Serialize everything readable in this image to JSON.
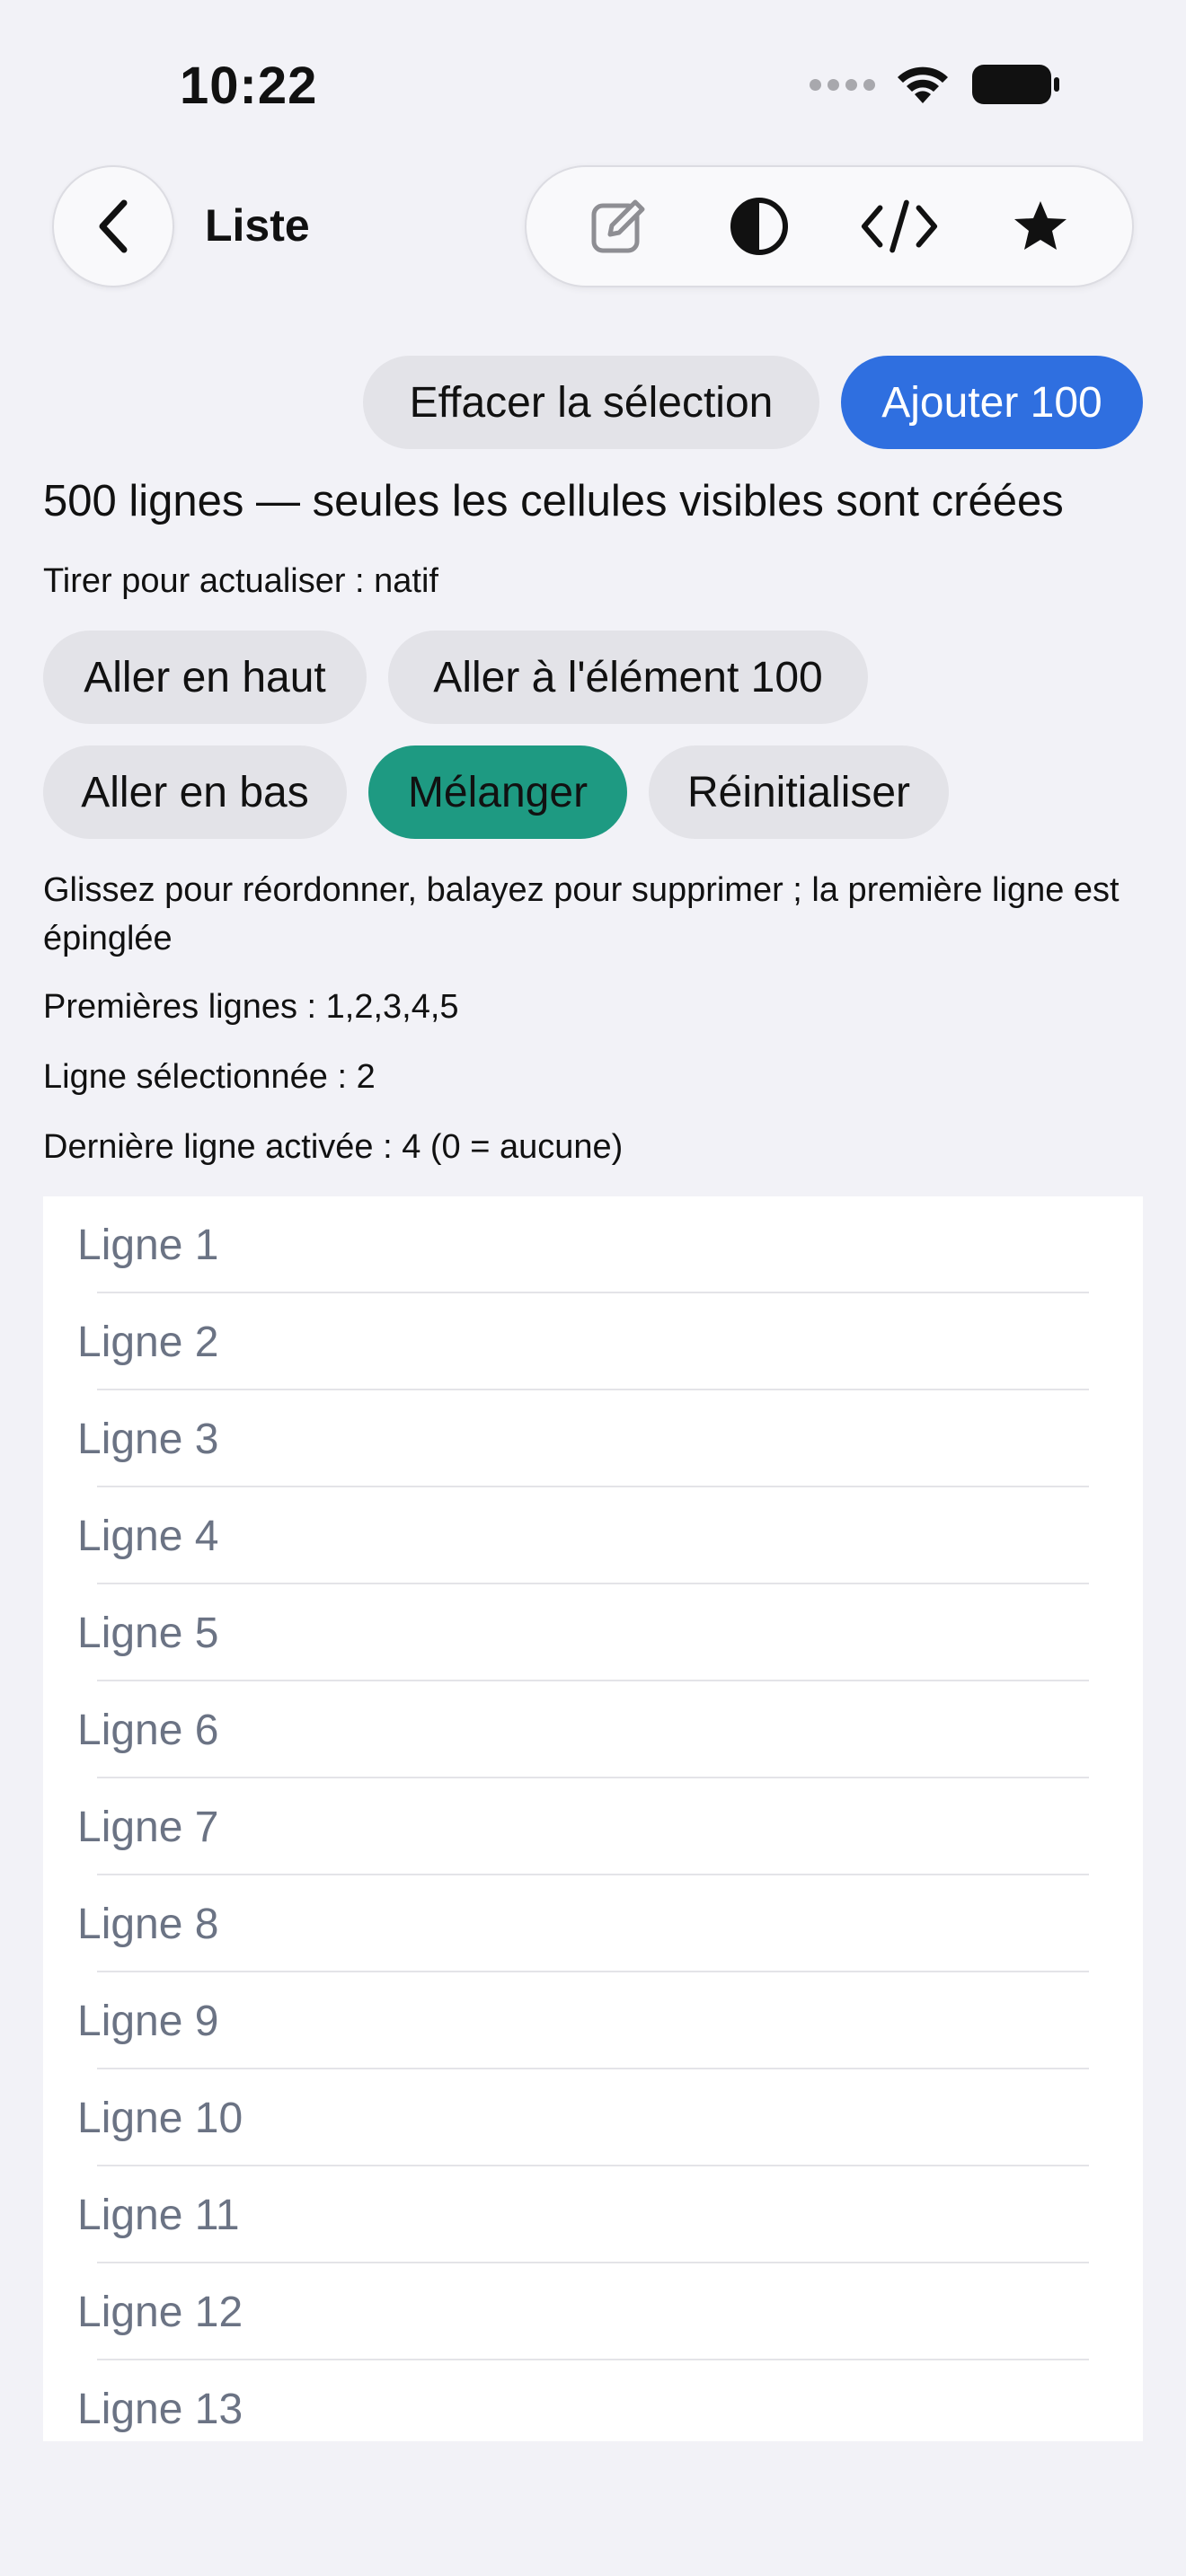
{
  "status": {
    "time": "10:22"
  },
  "nav": {
    "title": "Liste",
    "back_icon": "chevron-left-icon",
    "tools": [
      "edit-icon",
      "contrast-icon",
      "code-icon",
      "star-icon"
    ]
  },
  "actions": {
    "clear_selection": "Effacer la sélection",
    "add_100": "Ajouter 100"
  },
  "info": {
    "headline": "500 lignes — seules les cellules visibles sont créées",
    "pull_to_refresh": "Tirer pour actualiser : natif"
  },
  "controls": {
    "scroll_top": "Aller en haut",
    "scroll_to_100": "Aller à l'élément 100",
    "scroll_bottom": "Aller en bas",
    "shuffle": "Mélanger",
    "reset": "Réinitialiser"
  },
  "details": {
    "hint": "Glissez pour réordonner, balayez pour supprimer ; la première ligne est épinglée",
    "first_rows": "Premières lignes : 1,2,3,4,5",
    "selected_row": "Ligne sélectionnée : 2",
    "last_activated": "Dernière ligne activée : 4 (0 = aucune)"
  },
  "rows": [
    "Ligne 1",
    "Ligne 2",
    "Ligne 3",
    "Ligne 4",
    "Ligne 5",
    "Ligne 6",
    "Ligne 7",
    "Ligne 8",
    "Ligne 9",
    "Ligne 10",
    "Ligne 11",
    "Ligne 12",
    "Ligne 13"
  ],
  "colors": {
    "primary": "#2f6fe0",
    "accent_green": "#1e9a82",
    "row_text": "#6b7384",
    "background": "#f2f2f7"
  }
}
